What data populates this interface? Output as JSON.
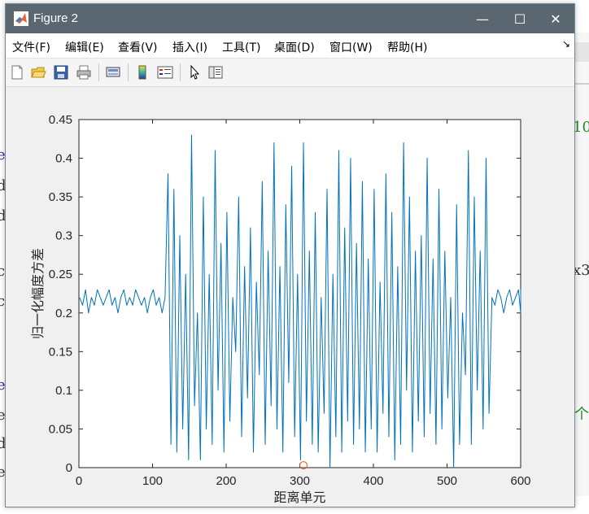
{
  "window": {
    "title": "Figure 2",
    "minimize_glyph": "—",
    "maximize_glyph": "☐",
    "close_glyph": "✕"
  },
  "menu": [
    "文件(F)",
    "编辑(E)",
    "查看(V)",
    "插入(I)",
    "工具(T)",
    "桌面(D)",
    "窗口(W)",
    "帮助(H)"
  ],
  "menu_corner_glyph": "↘",
  "toolbar_icons": [
    "new-figure-icon",
    "open-file-icon",
    "save-icon",
    "print-icon",
    "link-icon",
    "colorbar-icon",
    "legend-icon",
    "pointer-icon",
    "property-editor-icon"
  ],
  "background_code": {
    "left_chars": [
      "e",
      "d",
      "d",
      "c",
      "c",
      "e",
      "e",
      "d",
      "e"
    ],
    "right_chars": [
      "10",
      "x3",
      "个"
    ]
  },
  "colors": {
    "line": "#0072BD",
    "marker": "#D95319",
    "titlebar": "#5b6770"
  },
  "chart_data": {
    "type": "line",
    "xlabel": "距离单元",
    "ylabel": "归一化幅度方差",
    "xlim": [
      0,
      600
    ],
    "ylim": [
      0,
      0.45
    ],
    "xticks": [
      "0",
      "100",
      "200",
      "300",
      "400",
      "500",
      "600"
    ],
    "yticks": [
      "0",
      "0.05",
      "0.1",
      "0.15",
      "0.2",
      "0.25",
      "0.3",
      "0.35",
      "0.4",
      "0.45"
    ],
    "grid": false,
    "marker_point": {
      "x": 305,
      "y": 0.003
    },
    "series": [
      {
        "x_start": 1,
        "x_step": 4,
        "values": [
          0.22,
          0.21,
          0.23,
          0.2,
          0.22,
          0.21,
          0.23,
          0.22,
          0.21,
          0.22,
          0.23,
          0.21,
          0.22,
          0.2,
          0.22,
          0.23,
          0.21,
          0.22,
          0.21,
          0.23,
          0.22,
          0.21,
          0.22,
          0.2,
          0.22,
          0.23,
          0.21,
          0.22,
          0.2,
          0.22,
          0.38,
          0.03,
          0.36,
          0.02,
          0.3,
          0.05,
          0.25,
          0.01,
          0.43,
          0.08,
          0.2,
          0.01,
          0.35,
          0.05,
          0.25,
          0.03,
          0.41,
          0.1,
          0.29,
          0.02,
          0.33,
          0.06,
          0.22,
          0.15,
          0.35,
          0.04,
          0.26,
          0.09,
          0.31,
          0.02,
          0.24,
          0.12,
          0.37,
          0.03,
          0.28,
          0.08,
          0.42,
          0.05,
          0.26,
          0.02,
          0.34,
          0.11,
          0.39,
          0.04,
          0.25,
          0.01,
          0.42,
          0.06,
          0.28,
          0.03,
          0.33,
          0.02,
          0.22,
          0.07,
          0.36,
          0.0,
          0.25,
          0.04,
          0.41,
          0.02,
          0.31,
          0.06,
          0.4,
          0.03,
          0.29,
          0.05,
          0.37,
          0.02,
          0.27,
          0.05,
          0.36,
          0.02,
          0.24,
          0.07,
          0.38,
          0.04,
          0.33,
          0.01,
          0.26,
          0.03,
          0.42,
          0.1,
          0.35,
          0.02,
          0.28,
          0.06,
          0.3,
          0.04,
          0.4,
          0.07,
          0.27,
          0.03,
          0.36,
          0.05,
          0.28,
          0.09,
          0.22,
          0.0,
          0.34,
          0.03,
          0.2,
          0.12,
          0.41,
          0.03,
          0.35,
          0.1,
          0.28,
          0.05,
          0.4,
          0.07,
          0.22,
          0.21,
          0.23,
          0.22,
          0.2,
          0.22,
          0.23,
          0.21,
          0.22,
          0.23,
          0.2,
          0.22,
          0.21,
          0.23,
          0.22,
          0.21,
          0.22,
          0.23,
          0.21,
          0.22
        ]
      }
    ]
  }
}
